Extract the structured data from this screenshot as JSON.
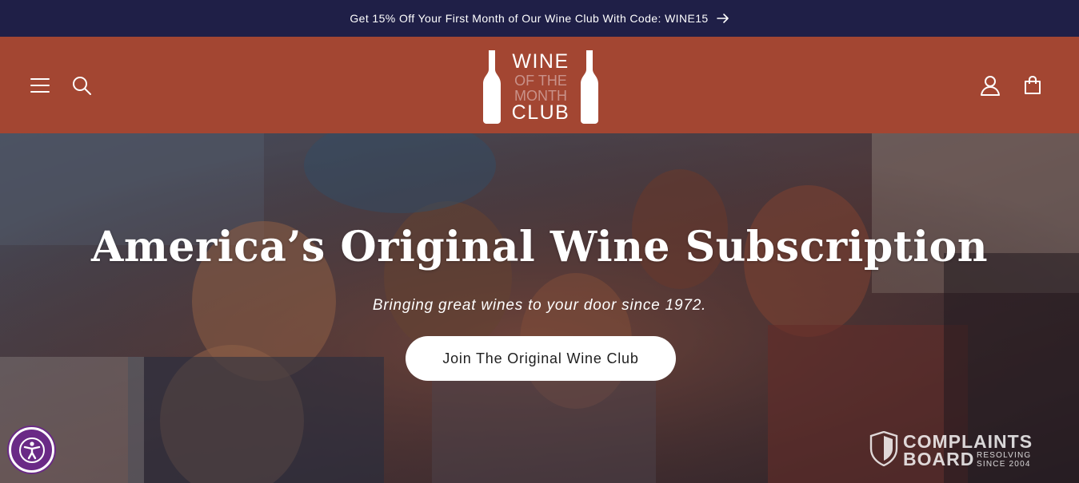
{
  "announcement": {
    "text": "Get 15% Off Your First Month of Our Wine Club With Code: WINE15"
  },
  "header": {
    "logo": {
      "line1": "WINE",
      "line2": "OF THE",
      "line3": "MONTH",
      "line4": "CLUB"
    },
    "icons": [
      "menu-icon",
      "search-icon",
      "account-icon",
      "cart-icon"
    ]
  },
  "hero": {
    "title": "America’s Original Wine Subscription",
    "subtitle": "Bringing great wines to your door since 1972.",
    "cta_label": "Join The Original Wine Club"
  },
  "watermark": {
    "line1": "COMPLAINTS",
    "line2": "BOARD",
    "tag1": "RESOLVING",
    "tag2": "SINCE 2004"
  },
  "colors": {
    "announcement_bg": "#1f1f47",
    "header_bg": "#a34632",
    "cta_bg": "#ffffff",
    "accessibility_bg": "#6a2a86"
  }
}
